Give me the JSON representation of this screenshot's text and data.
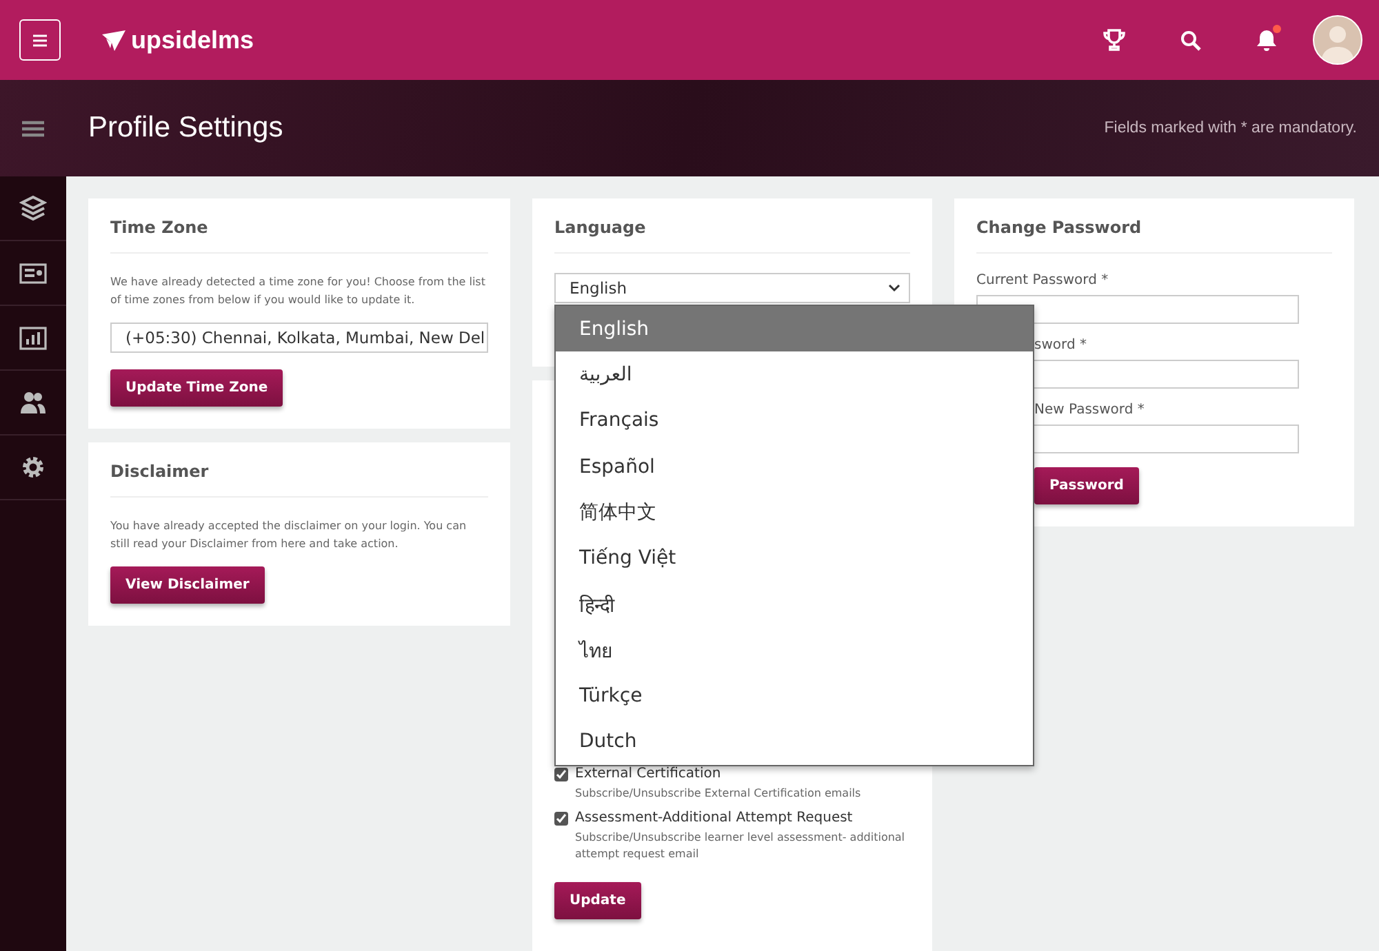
{
  "topbar": {
    "brand": "upsidelms",
    "notification_dot": true
  },
  "header": {
    "title": "Profile Settings",
    "note": "Fields marked with * are mandatory."
  },
  "time_zone": {
    "title": "Time Zone",
    "description": "We have already detected a time zone for you! Choose from the list of time zones from below if you would like to update it.",
    "value": "(+05:30) Chennai, Kolkata, Mumbai, New Del",
    "button": "Update Time Zone"
  },
  "disclaimer": {
    "title": "Disclaimer",
    "description": "You have already accepted the disclaimer on your login. You can still read your Disclaimer from here and take action.",
    "button": "View Disclaimer"
  },
  "language": {
    "title": "Language",
    "value": "English",
    "options": [
      {
        "label": "English",
        "selected": true
      },
      {
        "label": "العربية",
        "selected": false
      },
      {
        "label": "Français",
        "selected": false
      },
      {
        "label": "Español",
        "selected": false
      },
      {
        "label": "简体中文",
        "selected": false
      },
      {
        "label": "Tiếng Việt",
        "selected": false
      },
      {
        "label": "हिन्दी",
        "selected": false
      },
      {
        "label": "ไทย",
        "selected": false
      },
      {
        "label": "Türkçe",
        "selected": false
      },
      {
        "label": "Dutch",
        "selected": false
      }
    ]
  },
  "notifications": {
    "items": [
      {
        "label": "External Certification",
        "description": "Subscribe/Unsubscribe External Certification emails",
        "checked": true
      },
      {
        "label": "Assessment-Additional Attempt Request",
        "description": "Subscribe/Unsubscribe learner level assessment- additional attempt request email",
        "checked": true
      }
    ],
    "button": "Update"
  },
  "change_password": {
    "title": "Change Password",
    "fields": [
      {
        "label": "Current Password *"
      },
      {
        "label": "sword *"
      },
      {
        "label": "New Password *"
      }
    ],
    "button": "Password"
  }
}
